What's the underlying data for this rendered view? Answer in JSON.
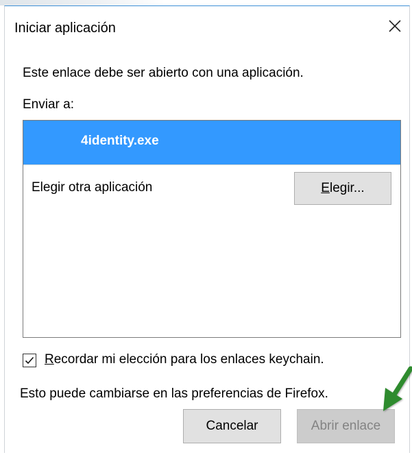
{
  "dialog": {
    "title": "Iniciar aplicación",
    "close_icon": "close-icon"
  },
  "content": {
    "message": "Este enlace debe ser abierto con una aplicación.",
    "send_to_label": "Enviar a:"
  },
  "app_list": {
    "selected_app": "4identity.exe",
    "other_label": "Elegir otra aplicación",
    "choose_button_first": "E",
    "choose_button_rest": "legir..."
  },
  "remember": {
    "checked": true,
    "label_first": "R",
    "label_rest": "ecordar mi elección para los enlaces keychain."
  },
  "note": "Esto puede cambiarse en las preferencias de Firefox.",
  "buttons": {
    "cancel": "Cancelar",
    "open_link": "Abrir enlace"
  },
  "colors": {
    "selection": "#3399ff",
    "annotation_arrow": "#2e8b2e"
  }
}
